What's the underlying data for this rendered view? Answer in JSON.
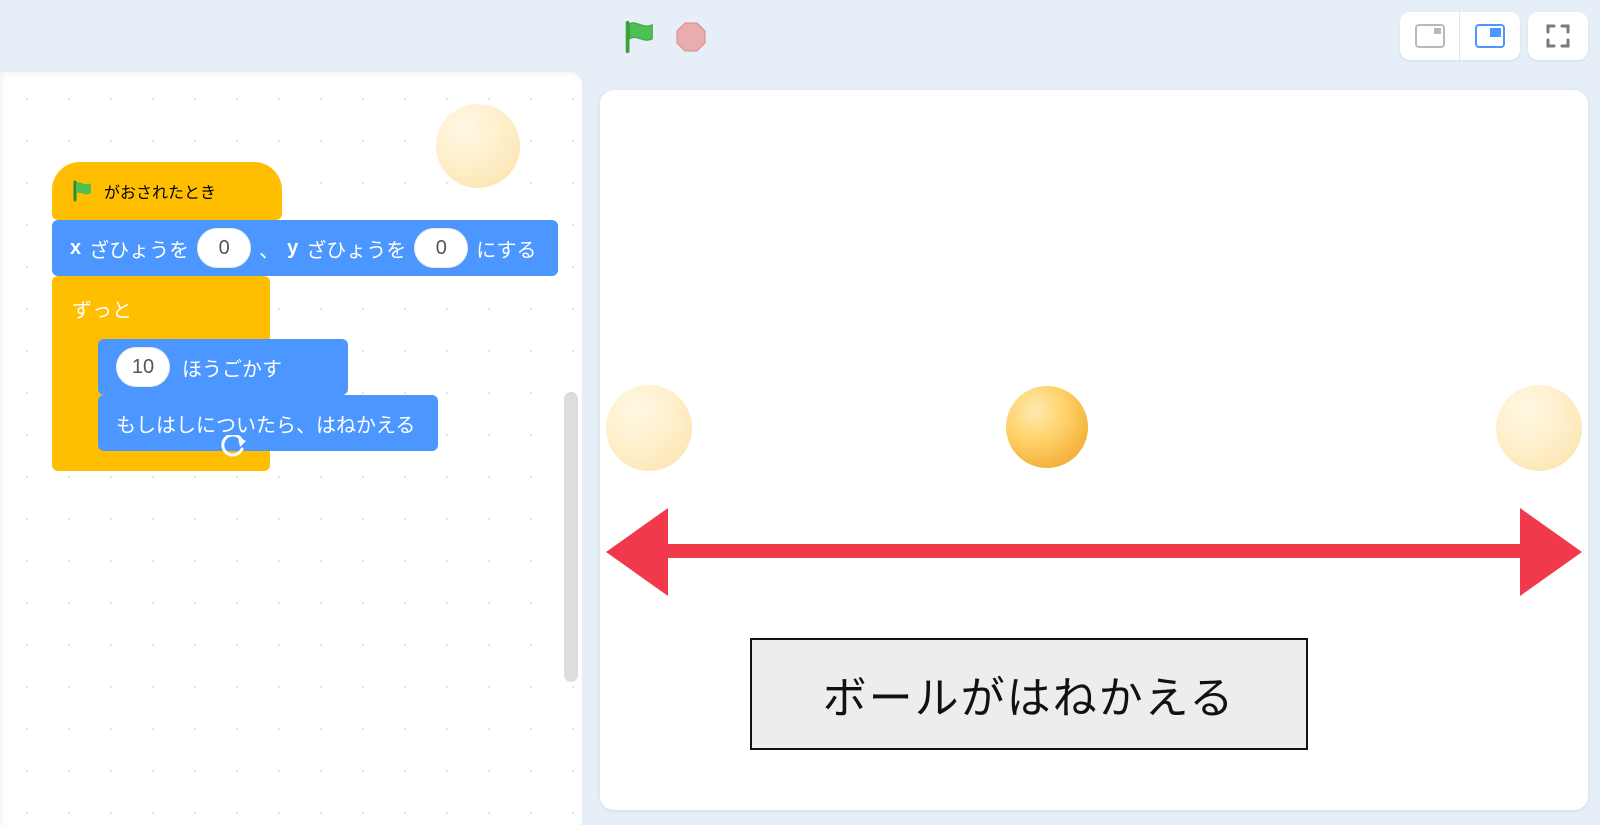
{
  "controls": {
    "green_flag": "green-flag",
    "stop": "stop"
  },
  "layout": {
    "small": "small-stage",
    "large": "large-stage",
    "fullscreen": "fullscreen"
  },
  "blocks": {
    "hat_label": "がおされたとき",
    "goto": {
      "x_prefix": "x",
      "x_suffix": "ざひょうを",
      "x_value": "0",
      "comma": "、",
      "y_prefix": "y",
      "y_suffix": "ざひょうを",
      "y_value": "0",
      "tail": "にする"
    },
    "forever_label": "ずっと",
    "move": {
      "steps": "10",
      "label": "ほうごかす"
    },
    "bounce_label": "もしはしについたら、はねかえる"
  },
  "stage": {
    "caption": "ボールがはねかえる"
  }
}
